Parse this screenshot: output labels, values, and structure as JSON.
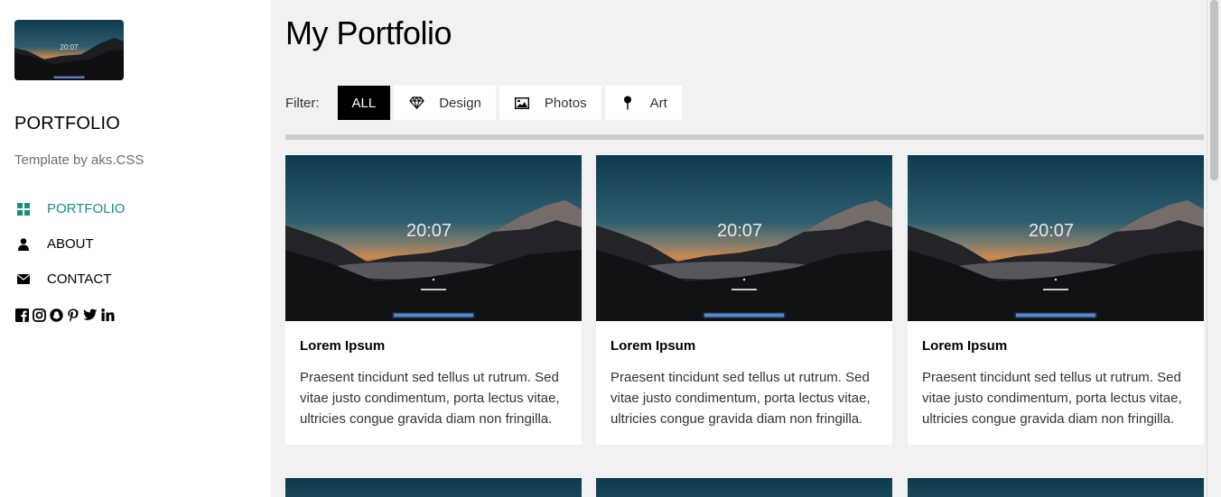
{
  "sidebar": {
    "logo_time": "20:07",
    "brand": "PORTFOLIO",
    "tagline": "Template by aks.CSS",
    "nav": [
      {
        "label": "PORTFOLIO",
        "icon": "grid-icon",
        "active": true
      },
      {
        "label": "ABOUT",
        "icon": "user-icon",
        "active": false
      },
      {
        "label": "CONTACT",
        "icon": "envelope-icon",
        "active": false
      }
    ],
    "social": [
      "facebook-icon",
      "instagram-icon",
      "snapchat-icon",
      "pinterest-icon",
      "twitter-icon",
      "linkedin-icon"
    ]
  },
  "main": {
    "title": "My Portfolio",
    "filter_label": "Filter:",
    "filters": [
      {
        "label": "ALL",
        "icon": "",
        "active": true
      },
      {
        "label": "Design",
        "icon": "diamond-icon",
        "active": false
      },
      {
        "label": "Photos",
        "icon": "image-icon",
        "active": false
      },
      {
        "label": "Art",
        "icon": "pin-icon",
        "active": false
      }
    ],
    "cards": [
      {
        "time": "20:07",
        "title": "Lorem Ipsum",
        "text": "Praesent tincidunt sed tellus ut rutrum. Sed vitae justo condimentum, porta lectus vitae, ultricies congue gravida diam non fringilla."
      },
      {
        "time": "20:07",
        "title": "Lorem Ipsum",
        "text": "Praesent tincidunt sed tellus ut rutrum. Sed vitae justo condimentum, porta lectus vitae, ultricies congue gravida diam non fringilla."
      },
      {
        "time": "20:07",
        "title": "Lorem Ipsum",
        "text": "Praesent tincidunt sed tellus ut rutrum. Sed vitae justo condimentum, porta lectus vitae, ultricies congue gravida diam non fringilla."
      }
    ]
  },
  "colors": {
    "accent": "#1a8f7c",
    "sidebar_bg": "#ffffff",
    "main_bg": "#f1f1f1",
    "active_filter_bg": "#000000"
  }
}
